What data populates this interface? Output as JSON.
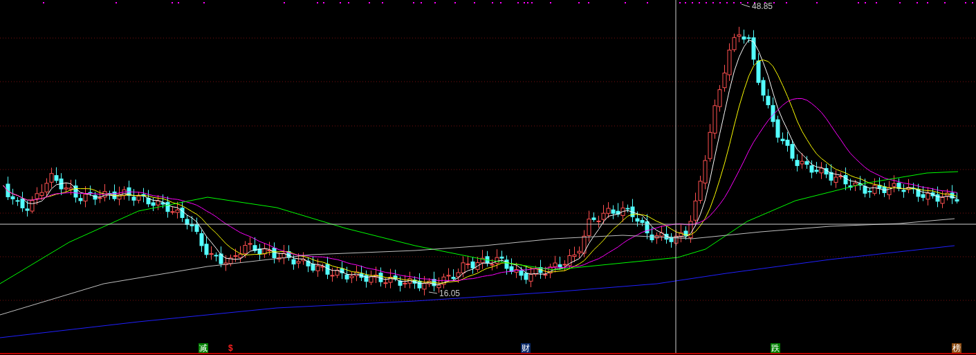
{
  "chart": {
    "high_label": "48.85",
    "low_label": "16.05"
  },
  "event_markers": [
    {
      "text": "减",
      "kind": "badge",
      "color": "#008000"
    },
    {
      "text": "$",
      "kind": "glyph",
      "color": "#ff2020"
    },
    {
      "text": "财",
      "kind": "badge",
      "color": "#0a2a6a"
    },
    {
      "text": "跌",
      "kind": "badge",
      "color": "#008000"
    },
    {
      "text": "榜",
      "kind": "badge",
      "color": "#8a4a10"
    }
  ]
}
